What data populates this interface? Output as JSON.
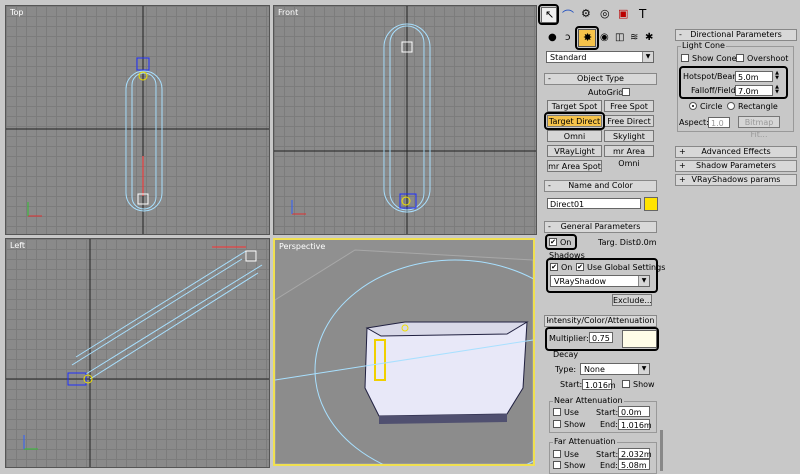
{
  "viewports": {
    "top": "Top",
    "front": "Front",
    "left": "Left",
    "perspective": "Perspective"
  },
  "create": {
    "category": "Standard",
    "object_type_title": "Object Type",
    "autogrid": "AutoGrid",
    "buttons": [
      "Target Spot",
      "Free Spot",
      "Target Direct",
      "Free Direct",
      "Omni",
      "Skylight",
      "VRayLight",
      "mr Area Omni",
      "mr Area Spot"
    ],
    "active_button": "Target Direct",
    "name_color_title": "Name and Color",
    "object_name": "Direct01",
    "swatch_color": "#ffe400"
  },
  "general": {
    "title": "General Parameters",
    "on_label": "On",
    "targ_dist_label": "Targ. Dist:",
    "targ_dist_value": "0.0m",
    "shadows_label": "Shadows",
    "shadows_on": "On",
    "use_global": "Use Global Settings",
    "shadow_type": "VRayShadow",
    "exclude": "Exclude..."
  },
  "intensity": {
    "title": "Intensity/Color/Attenuation",
    "multiplier_label": "Multiplier:",
    "multiplier_value": "0.75",
    "multiplier_color": "#fffde8",
    "decay_label": "Decay",
    "type_label": "Type:",
    "type_value": "None",
    "start_label": "Start:",
    "decay_start": "1.016m",
    "show_label": "Show",
    "near_title": "Near Attenuation",
    "use_label": "Use",
    "near_start": "0.0m",
    "end_label": "End:",
    "near_end": "1.016m",
    "far_title": "Far Attenuation",
    "far_start": "2.032m",
    "far_end": "5.08m"
  },
  "directional": {
    "title": "Directional Parameters",
    "light_cone": "Light Cone",
    "show_cone": "Show Cone",
    "overshoot": "Overshoot",
    "hotspot_label": "Hotspot/Beam:",
    "hotspot_value": "5.0m",
    "falloff_label": "Falloff/Field:",
    "falloff_value": "7.0m",
    "circle": "Circle",
    "rectangle": "Rectangle",
    "aspect_label": "Aspect:",
    "aspect_value": "1.0",
    "bitmap_fit": "Bitmap Fit..."
  },
  "collapsed": [
    "Advanced Effects",
    "Shadow Parameters",
    "VRayShadows params"
  ],
  "colors": {
    "highlight": "#000000",
    "active": "#f6c34a",
    "light_blue": "#a8e0ff",
    "perspective_border": "#f0e050"
  }
}
